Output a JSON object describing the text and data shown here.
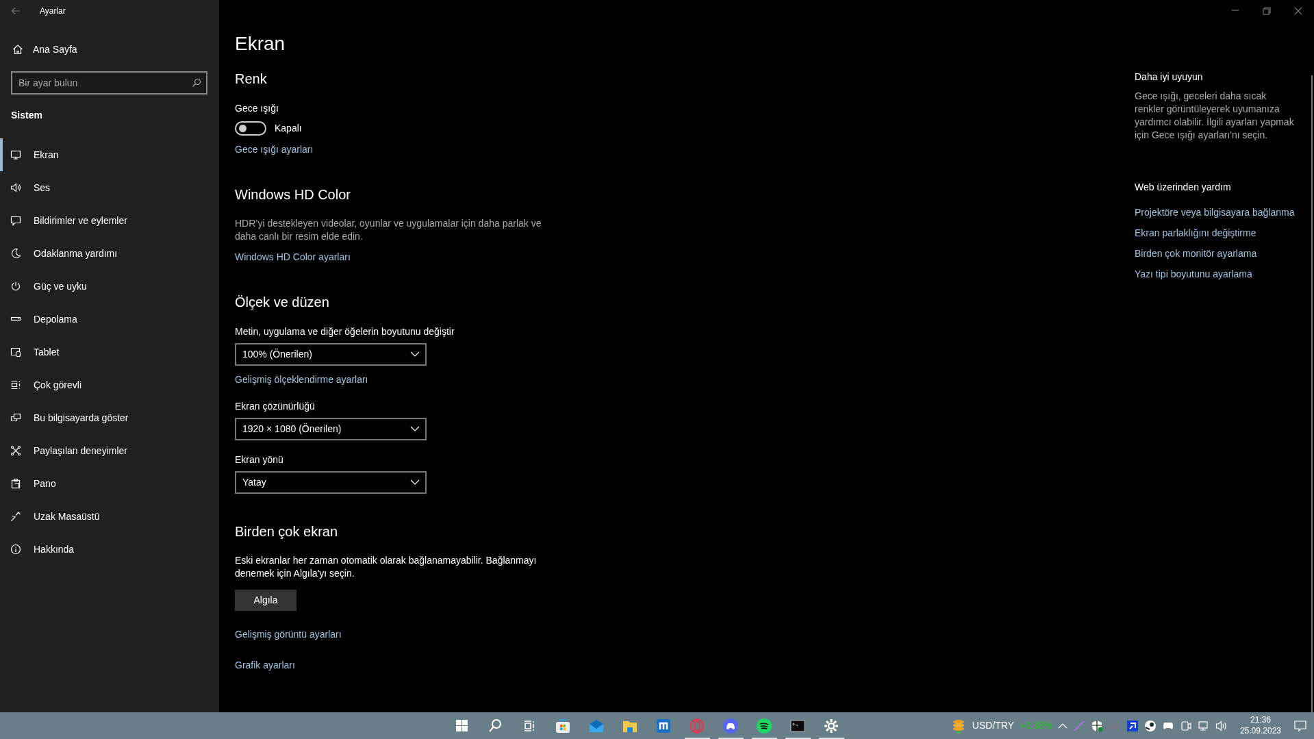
{
  "window": {
    "title": "Ayarlar"
  },
  "sidebar": {
    "home": "Ana Sayfa",
    "search": {
      "placeholder": "Bir ayar bulun"
    },
    "section": "Sistem",
    "items": [
      {
        "label": "Ekran",
        "selected": true
      },
      {
        "label": "Ses",
        "selected": false
      },
      {
        "label": "Bildirimler ve eylemler",
        "selected": false
      },
      {
        "label": "Odaklanma yardımı",
        "selected": false
      },
      {
        "label": "Güç ve uyku",
        "selected": false
      },
      {
        "label": "Depolama",
        "selected": false
      },
      {
        "label": "Tablet",
        "selected": false
      },
      {
        "label": "Çok görevli",
        "selected": false
      },
      {
        "label": "Bu bilgisayarda göster",
        "selected": false
      },
      {
        "label": "Paylaşılan deneyimler",
        "selected": false
      },
      {
        "label": "Pano",
        "selected": false
      },
      {
        "label": "Uzak Masaüstü",
        "selected": false
      },
      {
        "label": "Hakkında",
        "selected": false
      }
    ]
  },
  "main": {
    "title": "Ekran",
    "blocks": [
      {
        "kind": "heading",
        "text": "Renk"
      },
      {
        "kind": "label",
        "text": "Gece ışığı"
      },
      {
        "kind": "toggle",
        "on": false,
        "text": "Kapalı"
      },
      {
        "kind": "link",
        "text": "Gece ışığı ayarları"
      },
      {
        "kind": "heading",
        "text": "Windows HD Color"
      },
      {
        "kind": "paragraph",
        "text": "HDR’yi destekleyen videolar, oyunlar ve uygulamalar için daha parlak ve daha canlı bir resim elde edin."
      },
      {
        "kind": "link",
        "text": "Windows HD Color ayarları"
      },
      {
        "kind": "heading",
        "text": "Ölçek ve düzen"
      },
      {
        "kind": "label",
        "text": "Metin, uygulama ve diğer öğelerin boyutunu değiştir"
      },
      {
        "kind": "dropdown",
        "text": "100% (Önerilen)"
      },
      {
        "kind": "link",
        "text": "Gelişmiş ölçeklendirme ayarları"
      },
      {
        "kind": "label",
        "text": "Ekran çözünürlüğü"
      },
      {
        "kind": "dropdown",
        "text": "1920 × 1080 (Önerilen)"
      },
      {
        "kind": "label",
        "text": "Ekran yönü"
      },
      {
        "kind": "dropdown",
        "text": "Yatay"
      },
      {
        "kind": "heading",
        "text": "Birden çok ekran"
      },
      {
        "kind": "label",
        "text": "Eski ekranlar her zaman otomatik olarak bağlanamayabilir. Bağlanmayı denemek için Algıla'yı seçin."
      },
      {
        "kind": "button",
        "text": "Algıla"
      },
      {
        "kind": "link",
        "text": "Gelişmiş görüntü ayarları"
      },
      {
        "kind": "link",
        "text": "Grafik ayarları"
      }
    ]
  },
  "help_panel": {
    "sections": [
      {
        "title": "Daha iyi uyuyun",
        "text": "Gece ışığı, geceleri daha sıcak renkler görüntüleyerek uyumanıza yardımcı olabilir. İlgili ayarları yapmak için Gece ışığı ayarları'nı seçin."
      },
      {
        "title": "Web üzerinden yardım",
        "links": [
          "Projektöre veya bilgisayara bağlanma",
          "Ekran parlaklığını değiştirme",
          "Birden çok monitör ayarlama",
          "Yazı tipi boyutunu ayarlama"
        ]
      }
    ]
  },
  "taskbar": {
    "apps": [
      {
        "running": false
      },
      {
        "running": false
      },
      {
        "running": false
      },
      {
        "running": false
      },
      {
        "running": false
      },
      {
        "running": false
      },
      {
        "running": false
      },
      {
        "running": true
      },
      {
        "running": true
      },
      {
        "running": true
      },
      {
        "running": true
      },
      {
        "running": true
      }
    ],
    "ticker": {
      "symbol": "USD/TRY",
      "change": "+0.38%"
    },
    "clock": {
      "time": "21:36",
      "date": "25.09.2023"
    }
  }
}
